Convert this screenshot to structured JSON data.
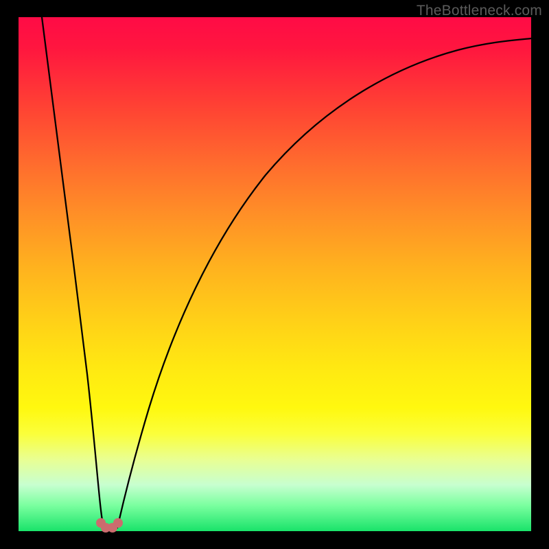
{
  "watermark": "TheBottleneck.com",
  "colors": {
    "frame": "#000000",
    "curve": "#000000",
    "dots": "#cb6c6e",
    "gradient_stops": [
      {
        "pct": 0,
        "hex": "#ff0b46"
      },
      {
        "pct": 18,
        "hex": "#ff4433"
      },
      {
        "pct": 38,
        "hex": "#ff8e27"
      },
      {
        "pct": 60,
        "hex": "#ffd317"
      },
      {
        "pct": 76,
        "hex": "#fff80f"
      },
      {
        "pct": 91,
        "hex": "#c7ffd0"
      },
      {
        "pct": 100,
        "hex": "#19e36a"
      }
    ]
  },
  "chart_data": {
    "type": "line",
    "title": "",
    "xlabel": "",
    "ylabel": "",
    "xlim": [
      0,
      100
    ],
    "ylim": [
      0,
      100
    ],
    "grid": false,
    "legend": false,
    "series": [
      {
        "name": "left-branch",
        "x": [
          4.5,
          6,
          8,
          10,
          12,
          13,
          14,
          15,
          15.7
        ],
        "y": [
          100,
          88,
          70,
          50,
          28,
          17,
          9,
          3,
          0.7
        ]
      },
      {
        "name": "right-branch",
        "x": [
          18.6,
          20,
          22,
          25,
          29,
          34,
          40,
          48,
          58,
          70,
          84,
          100
        ],
        "y": [
          0.7,
          4,
          12,
          25,
          40,
          54,
          66,
          76,
          83.5,
          88.8,
          92.3,
          94.5
        ]
      }
    ],
    "markers": [
      {
        "x": 15.5,
        "y": 1.2
      },
      {
        "x": 16.4,
        "y": 0.5
      },
      {
        "x": 17.6,
        "y": 0.5
      },
      {
        "x": 18.7,
        "y": 1.2
      }
    ]
  }
}
